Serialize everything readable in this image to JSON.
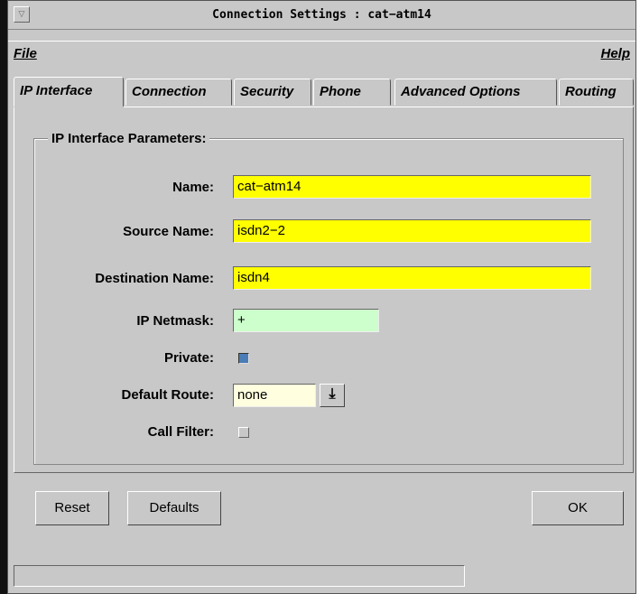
{
  "window": {
    "title": "Connection Settings : cat−atm14",
    "system_menu_glyph": "▽"
  },
  "menubar": {
    "file_label": "File",
    "help_label": "Help"
  },
  "tabs": [
    {
      "label": "IP Interface",
      "active": true
    },
    {
      "label": "Connection",
      "active": false
    },
    {
      "label": "Security",
      "active": false
    },
    {
      "label": "Phone",
      "active": false
    },
    {
      "label": "Advanced Options",
      "active": false
    },
    {
      "label": "Routing",
      "active": false
    }
  ],
  "group": {
    "title": "IP Interface Parameters:",
    "fields": {
      "name": {
        "label": "Name:",
        "value": "cat−atm14"
      },
      "source_name": {
        "label": "Source Name:",
        "value": "isdn2−2"
      },
      "destination_name": {
        "label": "Destination Name:",
        "value": "isdn4"
      },
      "ip_netmask": {
        "label": "IP Netmask:",
        "value": "+"
      },
      "private": {
        "label": "Private:",
        "checked": true
      },
      "default_route": {
        "label": "Default Route:",
        "value": "none",
        "dropdown_glyph": "⤓"
      },
      "call_filter": {
        "label": "Call Filter:",
        "checked": false
      }
    }
  },
  "buttons": {
    "reset": "Reset",
    "defaults": "Defaults",
    "ok": "OK"
  },
  "colors": {
    "required_field": "#ffff00",
    "optional_field": "#ccffcc",
    "select_field": "#ffffe0",
    "window_bg": "#c8c8c8",
    "checkbox_on": "#4a7db5"
  }
}
